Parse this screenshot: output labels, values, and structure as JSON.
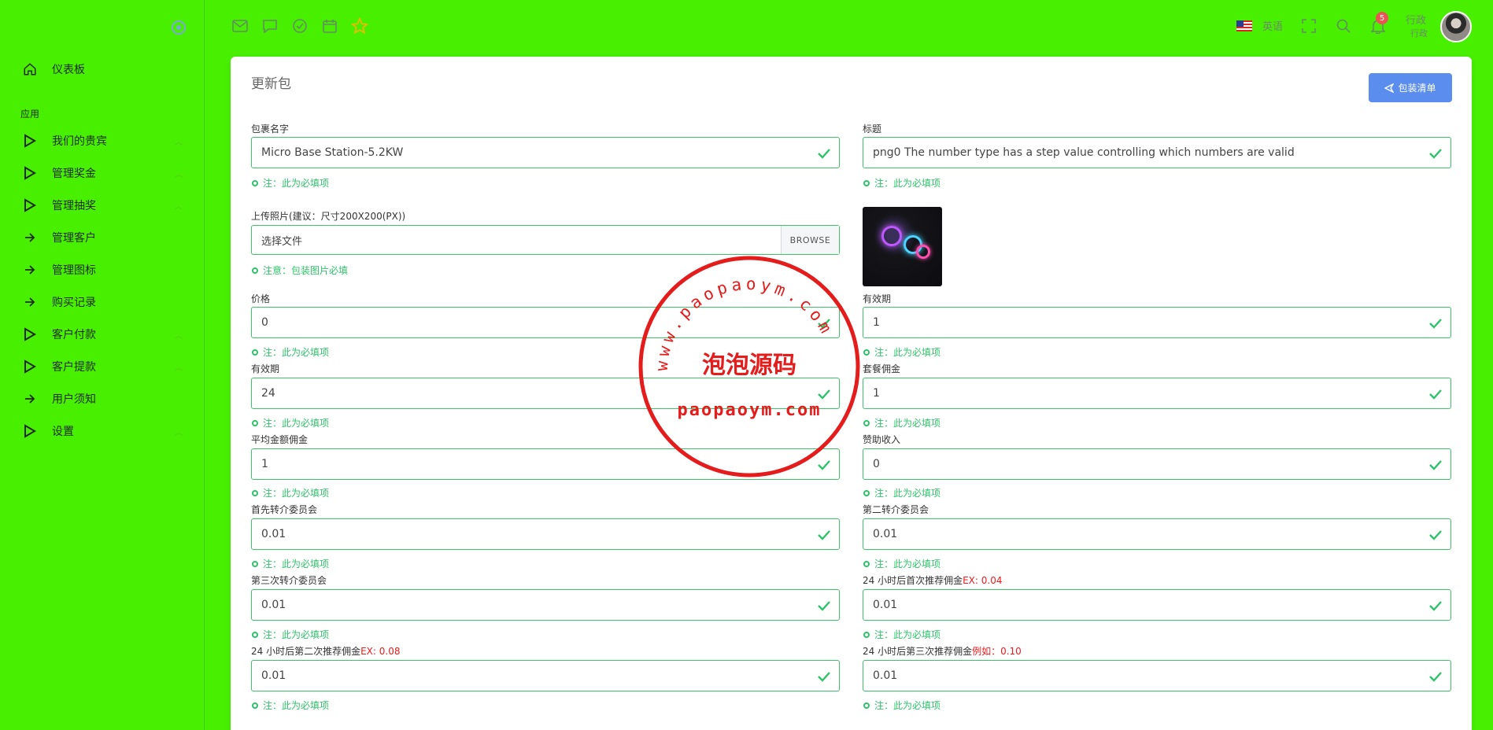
{
  "sidebar": {
    "section": "应用",
    "items": [
      {
        "label": "仪表板",
        "icon": "home-icon",
        "caret": false
      },
      {
        "label": "我们的贵宾",
        "icon": "play-icon",
        "caret": true
      },
      {
        "label": "管理奖金",
        "icon": "play-icon",
        "caret": true
      },
      {
        "label": "管理抽奖",
        "icon": "play-icon",
        "caret": true
      },
      {
        "label": "管理客户",
        "icon": "arrow-right-icon",
        "caret": false
      },
      {
        "label": "管理图标",
        "icon": "arrow-right-icon",
        "caret": false
      },
      {
        "label": "购买记录",
        "icon": "arrow-right-icon",
        "caret": false
      },
      {
        "label": "客户付款",
        "icon": "play-icon",
        "caret": true
      },
      {
        "label": "客户提款",
        "icon": "play-icon",
        "caret": true
      },
      {
        "label": "用户须知",
        "icon": "arrow-right-icon",
        "caret": false
      },
      {
        "label": "设置",
        "icon": "play-icon",
        "caret": true
      }
    ]
  },
  "topbar": {
    "icons": [
      "mail-icon",
      "chat-icon",
      "check-circle-icon",
      "calendar-icon",
      "star-icon"
    ],
    "language": "英语",
    "notification_count": "5",
    "user_name": "行政",
    "user_role": "行政"
  },
  "form": {
    "title": "更新包",
    "list_button": "包装清单",
    "required_note": "注：此为必填项",
    "image_note": "注意：包装图片必填",
    "package_name": {
      "label": "包裹名字",
      "value": "Micro Base Station-5.2KW"
    },
    "title_field": {
      "label": "标题",
      "value": "png0 The number type has a step value controlling which numbers are valid"
    },
    "upload": {
      "label": "上传照片(建议：尺寸200X200(PX))",
      "placeholder": "选择文件",
      "button": "BROWSE"
    },
    "price": {
      "label": "价格",
      "value": "0"
    },
    "validity_right": {
      "label": "有效期",
      "value": "1"
    },
    "validity": {
      "label": "有效期",
      "value": "24"
    },
    "package_commission": {
      "label": "套餐佣金",
      "value": "1"
    },
    "avg_commission": {
      "label": "平均金额佣金",
      "value": "1"
    },
    "sponsor_income": {
      "label": "赞助收入",
      "value": "0"
    },
    "first_referral": {
      "label": "首先转介委员会",
      "value": "0.01"
    },
    "second_referral": {
      "label": "第二转介委员会",
      "value": "0.01"
    },
    "third_referral": {
      "label": "第三次转介委员会",
      "value": "0.01"
    },
    "after24_first": {
      "label": "24 小时后首次推荐佣金",
      "ex": "EX: 0.04",
      "value": "0.01"
    },
    "after24_second": {
      "label": "24 小时后第二次推荐佣金",
      "ex": "EX: 0.08",
      "value": "0.01"
    },
    "after24_third": {
      "label": "24 小时后第三次推荐佣金",
      "ex": "例如：0.10",
      "value": "0.01"
    }
  },
  "watermark": {
    "arc_text": "www.paopaoym.com",
    "center_text": "泡泡源码",
    "bottom_text": "paopaoym.com"
  },
  "colors": {
    "background": "#48f000",
    "accent": "#5a8dee",
    "success": "#2ec36a",
    "stamp": "#e41c1c"
  }
}
